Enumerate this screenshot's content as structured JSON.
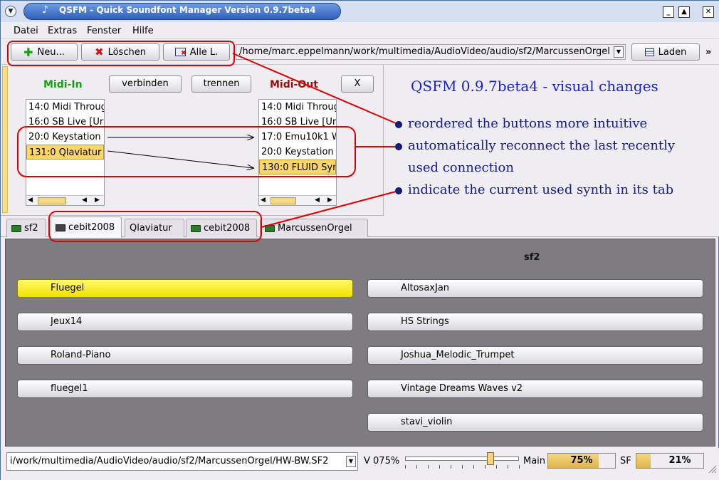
{
  "window": {
    "title": "QSFM - Quick Soundfont Manager Version 0.9.7beta4",
    "icons": {
      "menu": "window-menu-icon",
      "minimize": "minimize-icon",
      "maximize": "maximize-icon",
      "close": "close-icon"
    }
  },
  "menubar": [
    {
      "key": "datei",
      "label": "Datei"
    },
    {
      "key": "extras",
      "label": "Extras"
    },
    {
      "key": "fenster",
      "label": "Fenster"
    },
    {
      "key": "hilfe",
      "label": "Hilfe"
    }
  ],
  "toolbar": {
    "new_label": "Neu...",
    "delete_label": "Löschen",
    "delete_all_label": "Alle L.",
    "path": "/home/marc.eppelmann/work/multimedia/AudioVideo/audio/sf2/MarcussenOrgel",
    "load_label": "Laden",
    "more": "»"
  },
  "midi": {
    "in_label": "Midi-In",
    "out_label": "Midi-Out",
    "connect_label": "verbinden",
    "disconnect_label": "trennen",
    "close_label": "X",
    "in_ports": [
      {
        "label": "14:0 Midi Throug",
        "selected": false
      },
      {
        "label": "16:0 SB Live [Ur",
        "selected": false
      },
      {
        "label": "20:0 Keystation",
        "selected": false
      },
      {
        "label": "131:0 Qlaviatur",
        "selected": true
      }
    ],
    "out_ports": [
      {
        "label": "14:0 Midi Throug",
        "selected": false
      },
      {
        "label": "16:0 SB Live [Ur",
        "selected": false
      },
      {
        "label": "17:0 Emu10k1 W",
        "selected": false
      },
      {
        "label": "20:0 Keystation",
        "selected": false
      },
      {
        "label": "130:0 FLUID Syn",
        "selected": true
      }
    ]
  },
  "info": {
    "title": "QSFM 0.9.7beta4 - visual changes",
    "lines": [
      "reordered the buttons more intuitive",
      "automatically reconnect the last recently",
      "used connection",
      "indicate the current used synth in its tab"
    ]
  },
  "tabs": [
    {
      "label": "sf2",
      "icon": "synth-green-icon",
      "active": false
    },
    {
      "label": "cebit2008",
      "icon": "synth-grey-icon",
      "active": true
    },
    {
      "label": "Qlaviatur",
      "icon": "",
      "active": false
    },
    {
      "label": "cebit2008",
      "icon": "synth-green-icon",
      "active": false
    },
    {
      "label": "MarcussenOrgel",
      "icon": "synth-green-icon",
      "active": false
    }
  ],
  "content": {
    "heading": "sf2",
    "left_buttons": [
      {
        "label": "Fluegel",
        "active": true
      },
      {
        "label": "Jeux14",
        "active": false
      },
      {
        "label": "Roland-Piano",
        "active": false
      },
      {
        "label": "fluegel1",
        "active": false
      }
    ],
    "right_buttons": [
      {
        "label": "AltosaxJan",
        "active": false
      },
      {
        "label": "HS Strings",
        "active": false
      },
      {
        "label": "Joshua_Melodic_Trumpet",
        "active": false
      },
      {
        "label": "Vintage Dreams Waves v2",
        "active": false
      },
      {
        "label": "stavi_violin",
        "active": false
      }
    ]
  },
  "status": {
    "path": "i/work/multimedia/AudioVideo/audio/sf2/MarcussenOrgel/HW-BW.SF2",
    "volume_label": "V 075%",
    "volume_value": 0.75,
    "main_label": "Main",
    "main_value": "75%",
    "main_fraction": 0.75,
    "sf_label": "SF",
    "sf_value": "21%",
    "sf_fraction": 0.21
  },
  "colors": {
    "annotation": "#e00000",
    "info_text": "#121a8e",
    "active_sf": "#f5e600",
    "selection": "#fbd66a",
    "midi_in": "#17a017",
    "midi_out": "#9b0d0d"
  }
}
